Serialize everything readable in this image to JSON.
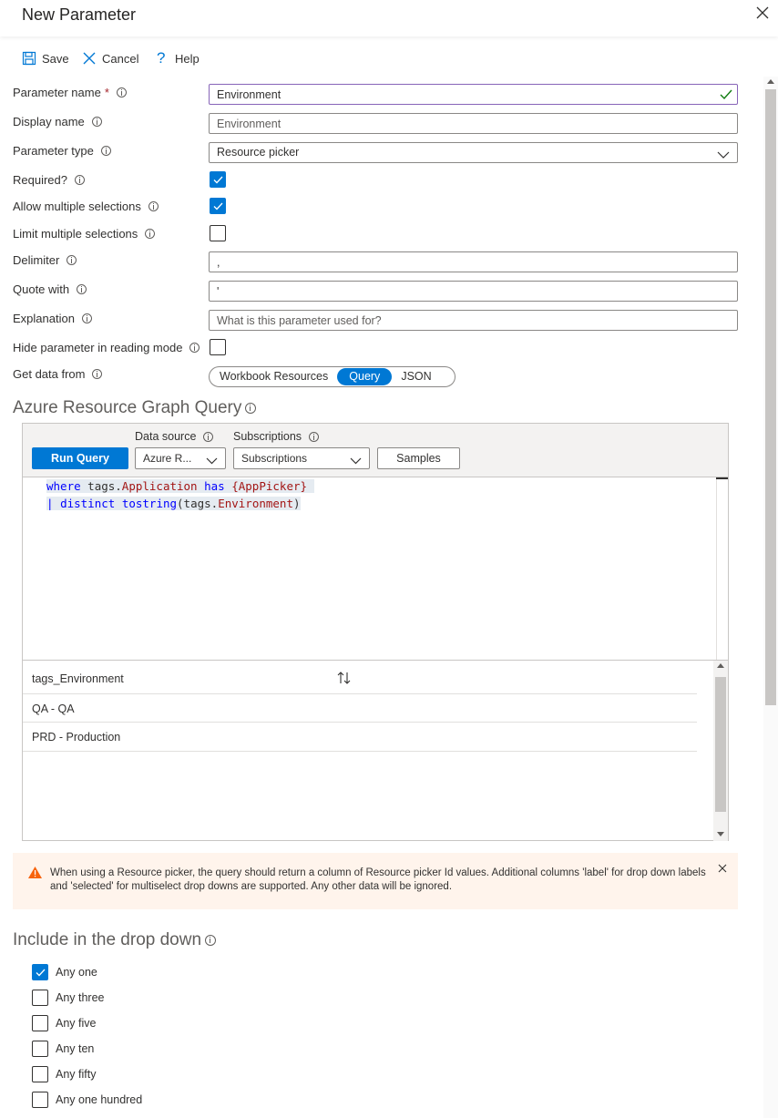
{
  "header": {
    "title": "New Parameter"
  },
  "toolbar": {
    "save_label": "Save",
    "cancel_label": "Cancel",
    "help_label": "Help"
  },
  "form": {
    "param_name_label": "Parameter name",
    "required_star": "*",
    "param_name_value": "Environment",
    "display_name_label": "Display name",
    "display_name_placeholder": "Environment",
    "param_type_label": "Parameter type",
    "param_type_value": "Resource picker",
    "required_label": "Required?",
    "required_checked": true,
    "allow_multi_label": "Allow multiple selections",
    "allow_multi_checked": true,
    "limit_multi_label": "Limit multiple selections",
    "limit_multi_checked": false,
    "delimiter_label": "Delimiter",
    "delimiter_value": ",",
    "quote_label": "Quote with",
    "quote_value": "'",
    "explanation_label": "Explanation",
    "explanation_placeholder": "What is this parameter used for?",
    "hide_label": "Hide parameter in reading mode",
    "hide_checked": false,
    "get_data_label": "Get data from",
    "get_data_options": [
      "Workbook Resources",
      "Query",
      "JSON"
    ],
    "get_data_selected": "Query"
  },
  "query": {
    "section_title": "Azure Resource Graph Query",
    "run_label": "Run Query",
    "data_source_label": "Data source",
    "data_source_value": "Azure R...",
    "subscriptions_label": "Subscriptions",
    "subscriptions_value": "Subscriptions",
    "samples_label": "Samples",
    "code": {
      "l1_kw1": "where",
      "l1_t1": " tags.",
      "l1_p1": "Application",
      "l1_t2": " ",
      "l1_kw2": "has",
      "l1_t3": " ",
      "l1_p2": "{AppPicker}",
      "l1_t4": " ",
      "l2_t0": "| ",
      "l2_kw1": "distinct",
      "l2_t1": " ",
      "l2_kw2": "tostring",
      "l2_t2": "(tags.",
      "l2_p1": "Environment",
      "l2_t3": ")"
    },
    "results": {
      "column": "tags_Environment",
      "rows": [
        "QA - QA",
        "PRD - Production"
      ]
    }
  },
  "warning": {
    "text": "When using a Resource picker, the query should return a column of Resource picker Id values. Additional columns 'label' for drop down labels and 'selected' for multiselect drop downs are supported. Any other data will be ignored."
  },
  "dropdown_section": {
    "title": "Include in the drop down",
    "items": [
      {
        "label": "Any one",
        "checked": true
      },
      {
        "label": "Any three",
        "checked": false
      },
      {
        "label": "Any five",
        "checked": false
      },
      {
        "label": "Any ten",
        "checked": false
      },
      {
        "label": "Any fifty",
        "checked": false
      },
      {
        "label": "Any one hundred",
        "checked": false
      }
    ]
  },
  "colors": {
    "accent": "#0078d4",
    "warning_bg": "#fff4ec",
    "warning_icon": "#f7630c",
    "focus_border": "#8764b8"
  }
}
